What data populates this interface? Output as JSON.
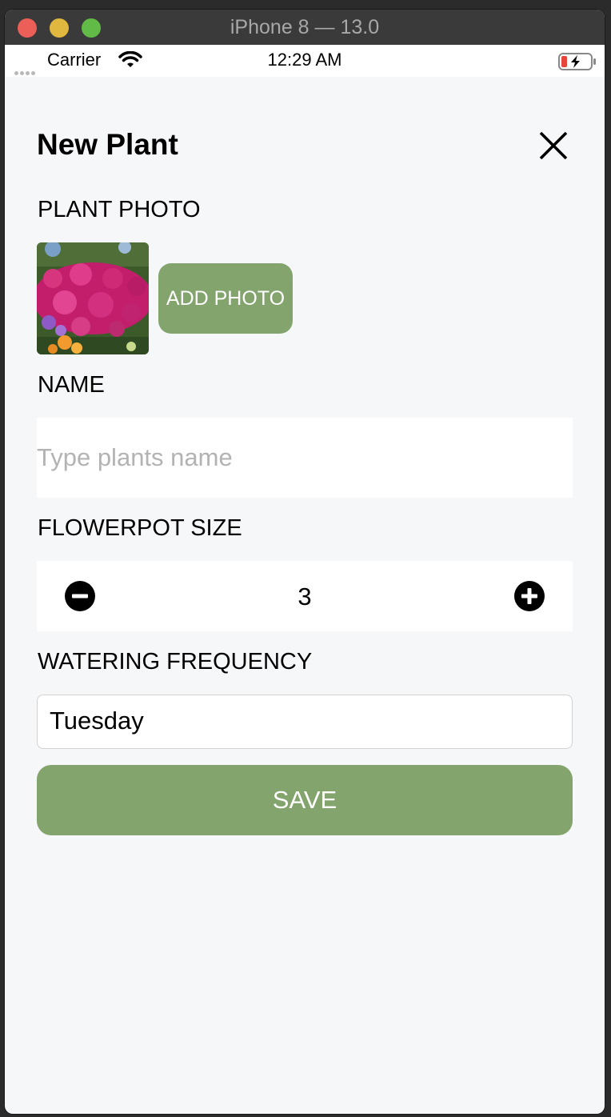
{
  "window": {
    "title": "iPhone 8 — 13.0"
  },
  "statusbar": {
    "carrier": "Carrier",
    "time": "12:29 AM"
  },
  "screen": {
    "title": "New Plant",
    "photo_label": "PLANT PHOTO",
    "add_photo_label": "ADD PHOTO",
    "name_label": "NAME",
    "name_placeholder": "Type plants name",
    "name_value": "",
    "flowerpot_label": "FLOWERPOT SIZE",
    "flowerpot_value": "3",
    "watering_label": "WATERING FREQUENCY",
    "watering_value": "Tuesday",
    "save_label": "SAVE"
  },
  "icons": [
    "close-icon",
    "minus-circle-icon",
    "plus-circle-icon",
    "wifi-icon",
    "battery-charging-icon",
    "signal-icon"
  ],
  "colors": {
    "accent": "#83a46d",
    "background": "#f6f7f9"
  }
}
